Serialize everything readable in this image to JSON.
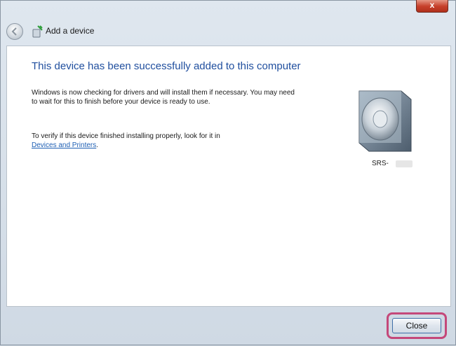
{
  "window": {
    "title": "Add a device",
    "close_glyph": "x"
  },
  "main": {
    "heading": "This device has been successfully added to this computer",
    "paragraph1": "Windows is now checking for drivers and will install them if necessary. You may need to wait for this to finish before your device is ready to use.",
    "paragraph2_prefix": "To verify if this device finished installing properly, look for it in",
    "paragraph2_link": "Devices and Printers",
    "paragraph2_suffix": ".",
    "device": {
      "label": "SRS-",
      "icon": "speaker-icon"
    }
  },
  "footer": {
    "close_label": "Close"
  },
  "colors": {
    "heading": "#1f4e9e",
    "link": "#1e5fb4",
    "highlight": "#c4487a"
  }
}
